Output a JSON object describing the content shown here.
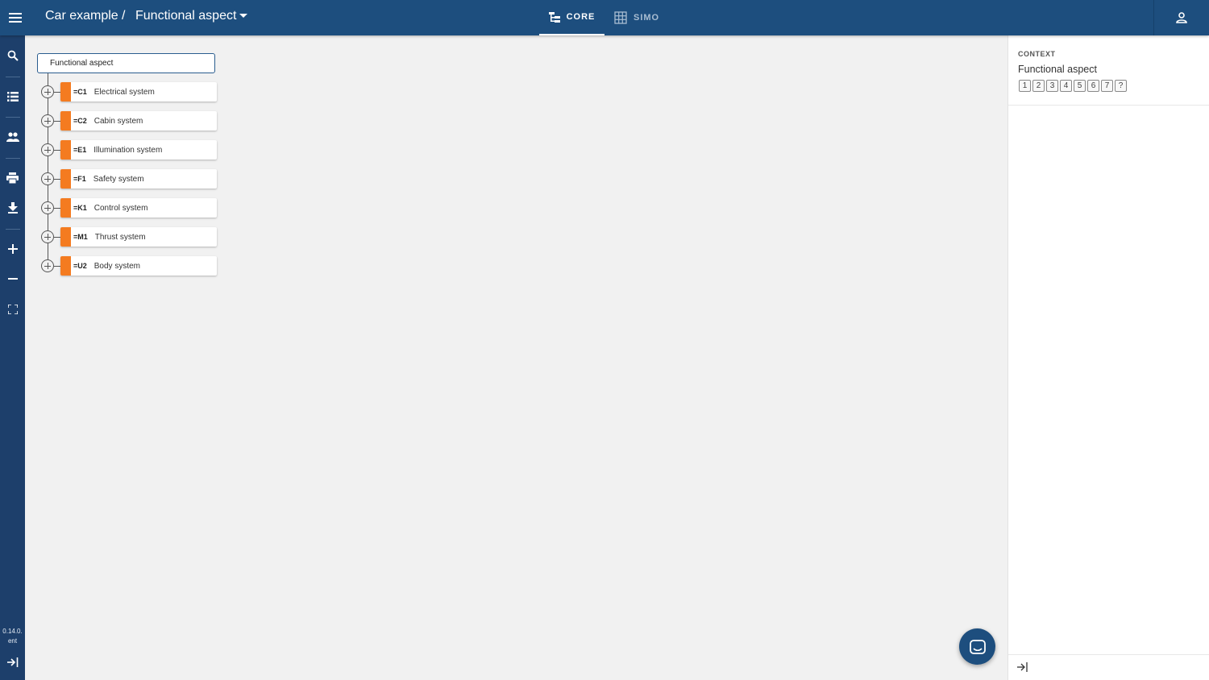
{
  "header": {
    "project": "Car example",
    "separator": "/",
    "aspect": "Functional aspect",
    "tabs": [
      {
        "label": "CORE",
        "active": true
      },
      {
        "label": "SIMO",
        "active": false
      }
    ]
  },
  "rail": {
    "items": [
      "search-icon",
      "list-icon",
      "people-icon",
      "print-icon",
      "download-icon",
      "zoom-in-icon",
      "zoom-out-icon",
      "fit-screen-icon"
    ],
    "version_line1": "0.14.0.",
    "version_line2": "ent"
  },
  "tree": {
    "root": "Functional aspect",
    "nodes": [
      {
        "code": "=C1",
        "name": "Electrical system"
      },
      {
        "code": "=C2",
        "name": "Cabin system"
      },
      {
        "code": "=E1",
        "name": "Illumination system"
      },
      {
        "code": "=F1",
        "name": "Safety system"
      },
      {
        "code": "=K1",
        "name": "Control system"
      },
      {
        "code": "=M1",
        "name": "Thrust system"
      },
      {
        "code": "=U2",
        "name": "Body system"
      }
    ]
  },
  "context": {
    "label": "CONTEXT",
    "title": "Functional aspect",
    "levels": [
      "1",
      "2",
      "3",
      "4",
      "5",
      "6",
      "7",
      "?"
    ]
  },
  "colors": {
    "topbar": "#1d4e7e",
    "rail": "#1d3f6b",
    "node_accent": "#f47b20",
    "canvas": "#f1f1f1"
  }
}
